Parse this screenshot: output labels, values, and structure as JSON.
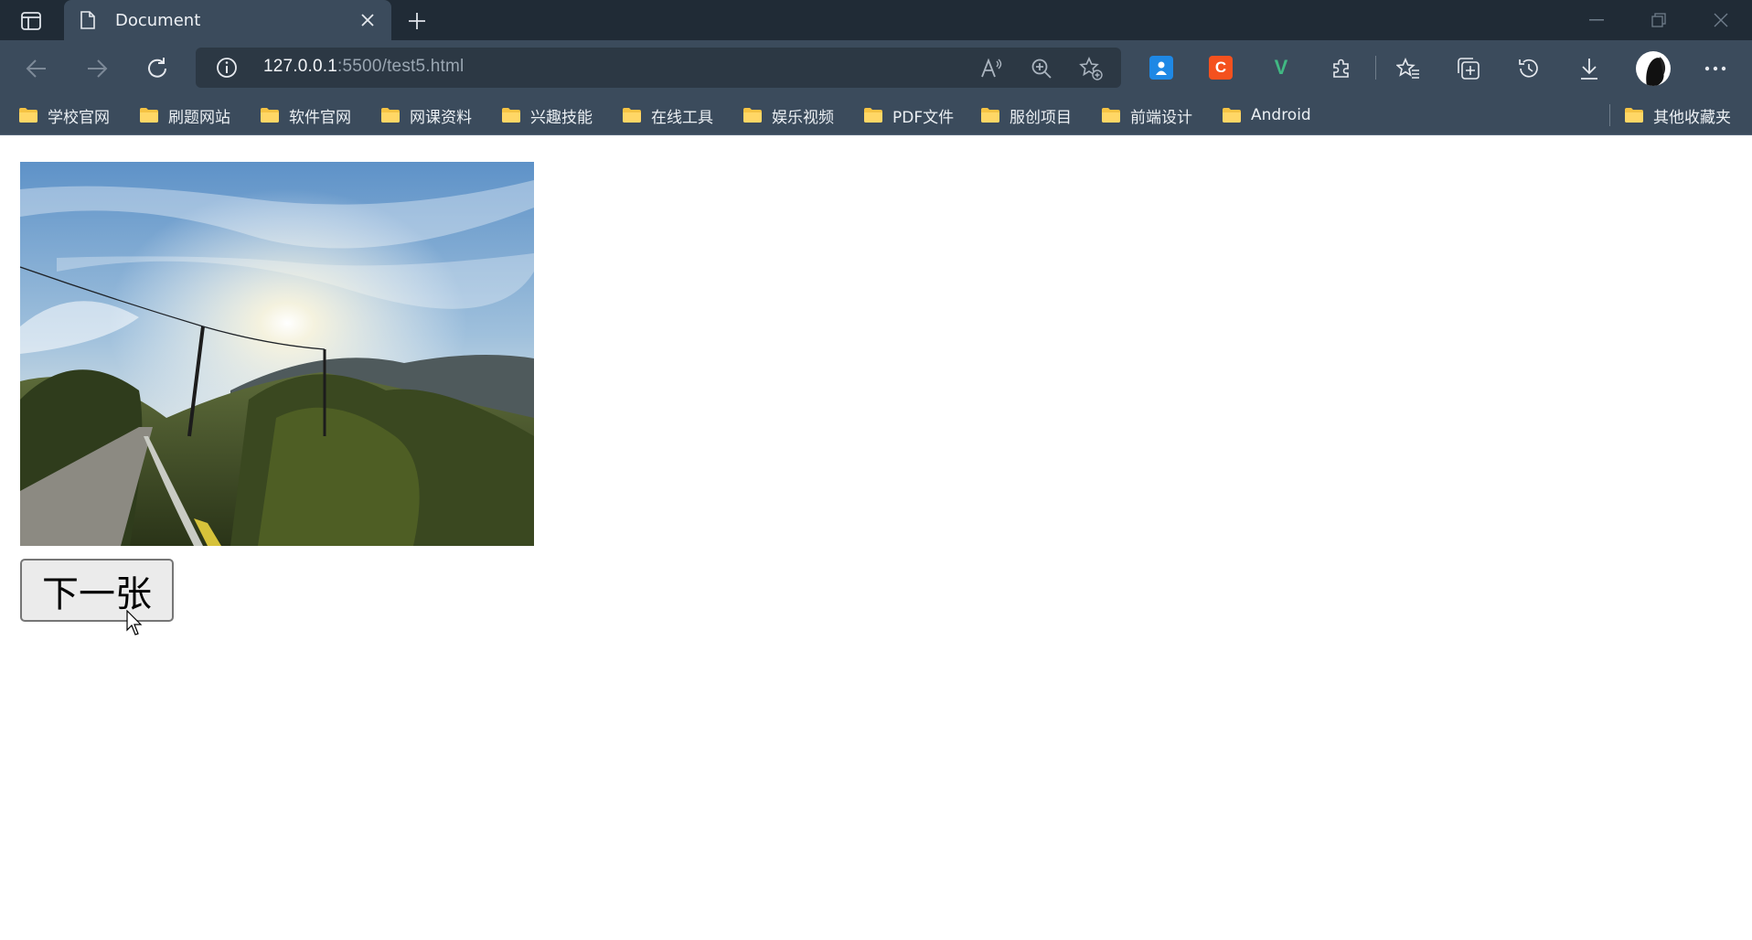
{
  "tab": {
    "title": "Document",
    "favicon": "page-icon"
  },
  "toolbar": {
    "url_host": "127.0.0.1",
    "url_rest": ":5500/test5.html"
  },
  "bookmarks": [
    {
      "label": "学校官网"
    },
    {
      "label": "刷题网站"
    },
    {
      "label": "软件官网"
    },
    {
      "label": "网课资料"
    },
    {
      "label": "兴趣技能"
    },
    {
      "label": "在线工具"
    },
    {
      "label": "娱乐视频"
    },
    {
      "label": "PDF文件"
    },
    {
      "label": "服创项目"
    },
    {
      "label": "前端设计"
    },
    {
      "label": "Android"
    }
  ],
  "other_bookmarks": "其他收藏夹",
  "extensions": [
    {
      "name": "translate-extension-icon",
      "color": "#1e88e5"
    },
    {
      "name": "c-extension-icon",
      "letter": "C",
      "color": "#f4511e"
    },
    {
      "name": "vue-devtools-icon",
      "letter": "V",
      "color": "#41b883"
    }
  ],
  "page": {
    "image_alt": "landscape-photo",
    "next_button_label": "下一张"
  }
}
